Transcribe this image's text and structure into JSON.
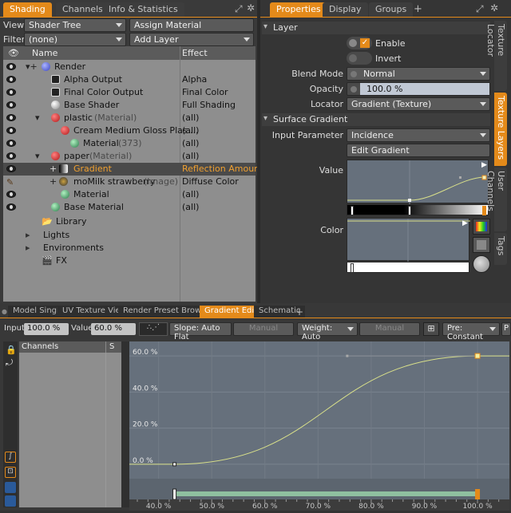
{
  "left_tabs": [
    "Shading",
    "Channels",
    "Info & Statistics"
  ],
  "right_tabs": [
    "Properties",
    "Display",
    "Groups"
  ],
  "plus": "+",
  "view_label": "View",
  "view_value": "Shader Tree",
  "assign_material": "Assign Material",
  "filter_label": "Filter",
  "filter_value": "(none)",
  "add_layer": "Add Layer",
  "tree": {
    "col_name": "Name",
    "col_effect": "Effect",
    "rows": [
      {
        "name": "Render",
        "effect": ""
      },
      {
        "name": "Alpha Output",
        "effect": "Alpha"
      },
      {
        "name": "Final Color Output",
        "effect": "Final Color"
      },
      {
        "name": "Base Shader",
        "effect": "Full Shading"
      },
      {
        "name": "plastic",
        "suffix": "(Material)",
        "effect": "(all)"
      },
      {
        "name": "Cream Medium Gloss Plas ...",
        "effect": "(all)"
      },
      {
        "name": "Material",
        "suffix": "(373)",
        "effect": "(all)"
      },
      {
        "name": "paper",
        "suffix": "(Material)",
        "effect": "(all)"
      },
      {
        "name": "Gradient",
        "effect": "Reflection Amount"
      },
      {
        "name": "moMilk strawberry",
        "suffix": "(Image)",
        "effect": "Diffuse Color"
      },
      {
        "name": "Material",
        "effect": "(all)"
      },
      {
        "name": "Base Material",
        "effect": "(all)"
      },
      {
        "name": "Library",
        "effect": ""
      },
      {
        "name": "Lights",
        "effect": ""
      },
      {
        "name": "Environments",
        "effect": ""
      },
      {
        "name": "FX",
        "effect": ""
      }
    ]
  },
  "props": {
    "layer_header": "Layer",
    "enable": "Enable",
    "invert": "Invert",
    "blend_mode_label": "Blend Mode",
    "blend_mode": "Normal",
    "opacity_label": "Opacity",
    "opacity": "100.0 %",
    "opacity_fill": 1.0,
    "locator_label": "Locator",
    "locator": "Gradient (Texture)",
    "surface_header": "Surface Gradient",
    "input_param_label": "Input Parameter",
    "input_param": "Incidence",
    "edit_gradient": "Edit Gradient",
    "value_label": "Value",
    "color_label": "Color"
  },
  "side_tabs": [
    "Texture Locator",
    "Texture Layers",
    "User Channels",
    "Tags"
  ],
  "bottom_tabs": [
    "Model Single",
    "UV Texture View",
    "Render Preset Browser",
    "Gradient Editor",
    "Schematic"
  ],
  "editor": {
    "input_label": "Input",
    "input_value": "100.0 %",
    "value_label": "Value",
    "value_value": "60.0 %",
    "slope": "Slope: Auto Flat",
    "manual1": "Manual",
    "weight": "Weight: Auto",
    "manual2": "Manual",
    "pre": "Pre: Constant",
    "p": "P",
    "channels": "Channels",
    "s": "S",
    "y_labels": [
      "60.0 %",
      "40.0 %",
      "20.0 %",
      "0.0 %"
    ],
    "x_labels": [
      "40.0 %",
      "50.0 %",
      "60.0 %",
      "70.0 %",
      "80.0 %",
      "90.0 %",
      "100.0 %"
    ]
  },
  "chart_data": {
    "type": "line",
    "x": [
      43,
      100
    ],
    "y": [
      0,
      60
    ],
    "xlabel": "",
    "ylabel": "",
    "xlim": [
      34.5,
      106
    ],
    "ylim": [
      -8,
      68
    ],
    "keys": [
      {
        "x": 43,
        "y": 0
      },
      {
        "x": 100,
        "y": 60
      }
    ]
  }
}
